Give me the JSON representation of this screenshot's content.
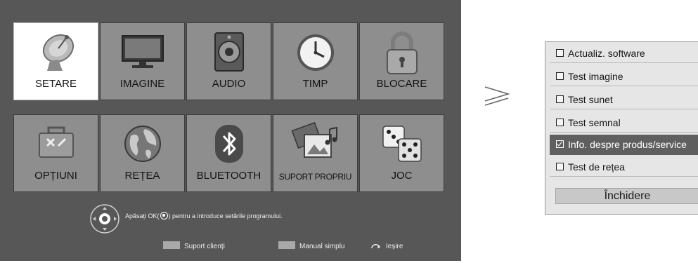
{
  "menu": {
    "tiles": [
      {
        "label": "SETARE",
        "icon": "satellite-dish-icon",
        "selected": true
      },
      {
        "label": "IMAGINE",
        "icon": "monitor-icon",
        "selected": false
      },
      {
        "label": "AUDIO",
        "icon": "speaker-icon",
        "selected": false
      },
      {
        "label": "TIMP",
        "icon": "clock-icon",
        "selected": false
      },
      {
        "label": "BLOCARE",
        "icon": "padlock-icon",
        "selected": false
      },
      {
        "label": "OPȚIUNI",
        "icon": "toolbox-icon",
        "selected": false
      },
      {
        "label": "REȚEA",
        "icon": "globe-icon",
        "selected": false
      },
      {
        "label": "BLUETOOTH",
        "icon": "bluetooth-icon",
        "selected": false
      },
      {
        "label": "SUPORT PROPRIU",
        "icon": "media-files-icon",
        "selected": false
      },
      {
        "label": "JOC",
        "icon": "dice-icon",
        "selected": false
      }
    ]
  },
  "hint": {
    "before": "Apăsați OK(",
    "after": ") pentru a introduce setările programului."
  },
  "footer": {
    "support": "Suport clienți",
    "manual": "Manual simplu",
    "exit": "Ieșire"
  },
  "separator_symbol": "≥",
  "submenu": {
    "items": [
      {
        "label": "Actualiz. software",
        "active": false
      },
      {
        "label": "Test imagine",
        "active": false
      },
      {
        "label": "Test sunet",
        "active": false
      },
      {
        "label": "Test semnal",
        "active": false
      },
      {
        "label": "Info. despre produs/service",
        "active": true
      },
      {
        "label": "Test de rețea",
        "active": false
      }
    ],
    "close_label": "Închidere"
  },
  "colors": {
    "screen_bg": "#575757",
    "tile_bg": "#8e8e8e",
    "tile_selected_bg": "#ffffff",
    "panel_bg": "#e6e6e6",
    "row_active_bg": "#5f5f5f"
  }
}
